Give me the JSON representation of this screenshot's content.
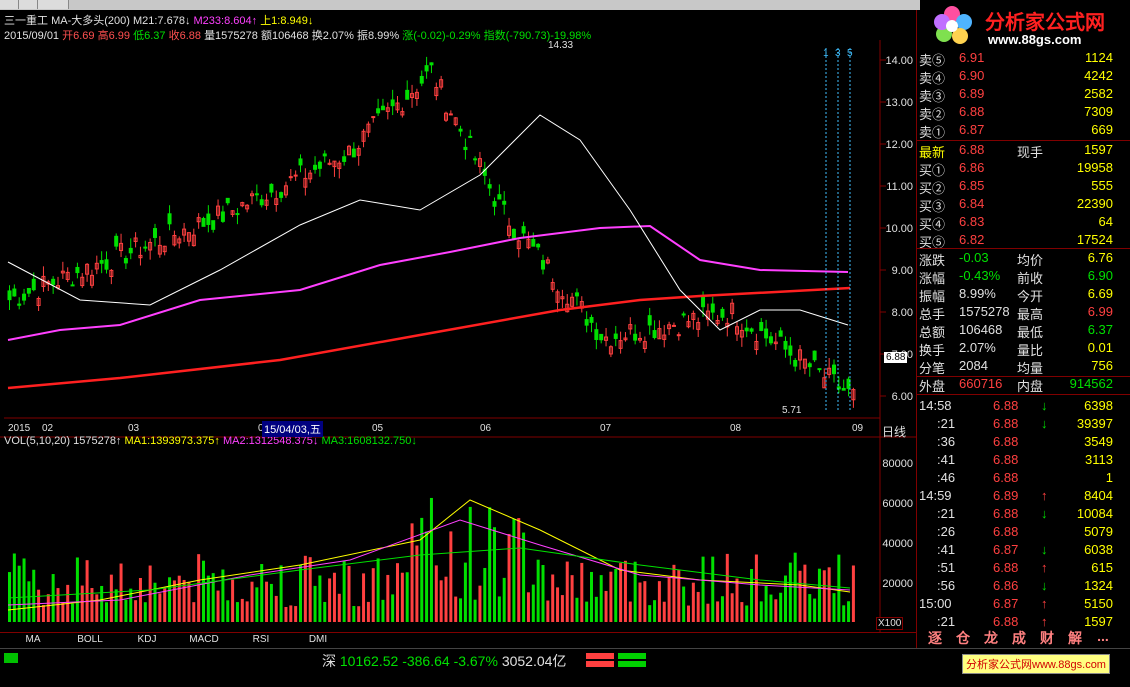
{
  "stock": {
    "name": "三一重工",
    "indicator": "MA-大多头(200)",
    "ma21": "M21:7.678↓",
    "ma233": "M233:8.604↑",
    "up": "上1:8.949↓"
  },
  "ohlc": {
    "date": "2015/09/01",
    "open": "开6.69",
    "high": "高6.99",
    "low": "低6.37",
    "close": "收6.88",
    "vol": "量1575278",
    "amount": "额106468",
    "turnover": "换2.07%",
    "amplitude": "振8.99%",
    "change": "涨(-0.02)-0.29%",
    "index": "指数(-790.73)-19.98%"
  },
  "price_axis": [
    "14.00",
    "13.00",
    "12.00",
    "11.00",
    "10.00",
    "9.00",
    "8.00",
    "7.00",
    "6.00"
  ],
  "current_price_tag": "6.88",
  "high_label": "14.33",
  "low_label": "5.71",
  "markers": [
    "1",
    "3",
    "5"
  ],
  "time_axis": [
    "2015",
    "02",
    "03",
    "04",
    "05",
    "06",
    "07",
    "08",
    "09"
  ],
  "cursor_date": "15/04/03,五",
  "period": "日线",
  "vol_info": {
    "label": "VOL(5,10,20)",
    "vol": "1575278↑",
    "ma1": "MA1:1393973.375↑",
    "ma2": "MA2:1312548.375↓",
    "ma3": "MA3:1608132.750↓"
  },
  "vol_axis": [
    "80000",
    "60000",
    "40000",
    "20000"
  ],
  "vol_unit": "X100",
  "bottom_tabs": [
    "MA",
    "BOLL",
    "KDJ",
    "MACD",
    "RSI",
    "DMI"
  ],
  "status": {
    "market": "深",
    "index": "10162.52",
    "change": "-386.64",
    "pct": "-3.67%",
    "amount": "3052.04亿"
  },
  "logo": {
    "title": "分析家公式网",
    "url": "www.88gs.com"
  },
  "footer_logo": "分析家公式网www.88gs.com",
  "order_book": {
    "sells": [
      {
        "label": "卖⑤",
        "price": "6.91",
        "vol": "1124"
      },
      {
        "label": "卖④",
        "price": "6.90",
        "vol": "4242"
      },
      {
        "label": "卖③",
        "price": "6.89",
        "vol": "2582"
      },
      {
        "label": "卖②",
        "price": "6.88",
        "vol": "7309"
      },
      {
        "label": "卖①",
        "price": "6.87",
        "vol": "669"
      }
    ],
    "latest": {
      "label": "最新",
      "price": "6.88",
      "k2": "现手",
      "v2": "1597"
    },
    "buys": [
      {
        "label": "买①",
        "price": "6.86",
        "vol": "19958"
      },
      {
        "label": "买②",
        "price": "6.85",
        "vol": "555"
      },
      {
        "label": "买③",
        "price": "6.84",
        "vol": "22390"
      },
      {
        "label": "买④",
        "price": "6.83",
        "vol": "64"
      },
      {
        "label": "买⑤",
        "price": "6.82",
        "vol": "17524"
      }
    ]
  },
  "stats": [
    {
      "k1": "涨跌",
      "v1": "-0.03",
      "k2": "均价",
      "v2": "6.76"
    },
    {
      "k1": "涨幅",
      "v1": "-0.43%",
      "k2": "前收",
      "v2": "6.90"
    },
    {
      "k1": "振幅",
      "v1": "8.99%",
      "k2": "今开",
      "v2": "6.69"
    },
    {
      "k1": "总手",
      "v1": "1575278",
      "k2": "最高",
      "v2": "6.99"
    },
    {
      "k1": "总额",
      "v1": "106468",
      "k2": "最低",
      "v2": "6.37"
    },
    {
      "k1": "换手",
      "v1": "2.07%",
      "k2": "量比",
      "v2": "0.01"
    },
    {
      "k1": "分笔",
      "v1": "2084",
      "k2": "均量",
      "v2": "756"
    }
  ],
  "outer_inner": {
    "k1": "外盘",
    "v1": "660716",
    "k2": "内盘",
    "v2": "914562"
  },
  "trades": [
    {
      "time": "14:58",
      "price": "6.88",
      "dir": "↓",
      "vol": "6398"
    },
    {
      "time": ":21",
      "price": "6.88",
      "dir": "↓",
      "vol": "39397"
    },
    {
      "time": ":36",
      "price": "6.88",
      "dir": "",
      "vol": "3549"
    },
    {
      "time": ":41",
      "price": "6.88",
      "dir": "",
      "vol": "3113"
    },
    {
      "time": ":46",
      "price": "6.88",
      "dir": "",
      "vol": "1"
    },
    {
      "time": "14:59",
      "price": "6.89",
      "dir": "↑",
      "vol": "8404"
    },
    {
      "time": ":21",
      "price": "6.88",
      "dir": "↓",
      "vol": "10084"
    },
    {
      "time": ":26",
      "price": "6.88",
      "dir": "",
      "vol": "5079"
    },
    {
      "time": ":41",
      "price": "6.87",
      "dir": "↓",
      "vol": "6038"
    },
    {
      "time": ":51",
      "price": "6.88",
      "dir": "↑",
      "vol": "615"
    },
    {
      "time": ":56",
      "price": "6.86",
      "dir": "↓",
      "vol": "1324"
    },
    {
      "time": "15:00",
      "price": "6.87",
      "dir": "↑",
      "vol": "5150"
    },
    {
      "time": ":21",
      "price": "6.88",
      "dir": "↑",
      "vol": "1597"
    }
  ],
  "panel_tabs": [
    "逐",
    "仓",
    "龙",
    "成",
    "财",
    "解",
    "..."
  ]
}
